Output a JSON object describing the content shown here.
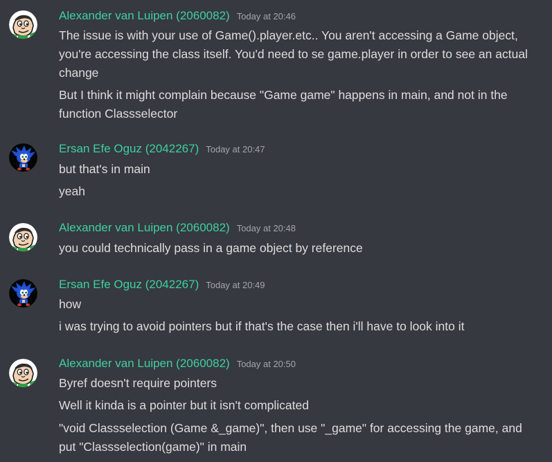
{
  "colors": {
    "background": "#36393f",
    "username_alex": "#3ed0a3",
    "username_ersan": "#3ed0a3",
    "text": "#dcddde",
    "timestamp": "#a3a6aa"
  },
  "messages": [
    {
      "author": "Alexander van Luipen (2060082)",
      "avatar": "cartoon-face-avatar",
      "timestamp": "Today at 20:46",
      "lines": [
        "The issue is with your use of Game().player.etc.. You aren't accessing a Game object, you're accessing the class itself. You'd need to se game.player in order to see an actual change",
        "But I think it might complain because \"Game game\" happens in main, and not in the function Classselector"
      ]
    },
    {
      "author": "Ersan Efe Oguz (2042267)",
      "avatar": "sonic-avatar",
      "timestamp": "Today at 20:47",
      "lines": [
        "but that's in main",
        "yeah"
      ]
    },
    {
      "author": "Alexander van Luipen (2060082)",
      "avatar": "cartoon-face-avatar",
      "timestamp": "Today at 20:48",
      "lines": [
        "you could technically pass in a game object by reference"
      ]
    },
    {
      "author": "Ersan Efe Oguz (2042267)",
      "avatar": "sonic-avatar",
      "timestamp": "Today at 20:49",
      "lines": [
        "how",
        "i was trying to avoid pointers but if that's the case then i'll have to look into it"
      ]
    },
    {
      "author": "Alexander van Luipen (2060082)",
      "avatar": "cartoon-face-avatar",
      "timestamp": "Today at 20:50",
      "lines": [
        "Byref doesn't require pointers",
        "Well it kinda is a pointer but it isn't complicated",
        "\"void Classselection (Game &_game)\", then use \"_game\" for accessing the game, and put \"Classselection(game)\" in main"
      ]
    }
  ]
}
